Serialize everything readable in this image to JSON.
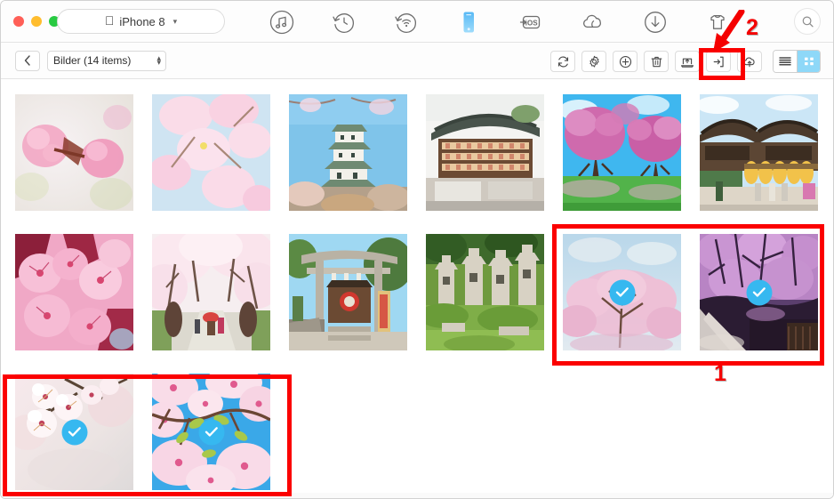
{
  "window": {
    "traffic_lights": [
      {
        "name": "close",
        "color": "#ff5f57"
      },
      {
        "name": "minimize",
        "color": "#ffbd2e"
      },
      {
        "name": "zoom",
        "color": "#28ca42"
      }
    ]
  },
  "header": {
    "device": {
      "label": "iPhone 8",
      "apple_glyph": "",
      "caret": "⌄"
    },
    "nav_items": [
      {
        "id": "music",
        "icon": "music-note-circle-icon",
        "active": false
      },
      {
        "id": "backup",
        "icon": "backup-restore-clock-icon",
        "active": false
      },
      {
        "id": "wireless",
        "icon": "wireless-sync-icon",
        "active": false
      },
      {
        "id": "device",
        "icon": "phone-device-icon",
        "active": true
      },
      {
        "id": "toios",
        "icon": "to-ios-transfer-icon",
        "active": false
      },
      {
        "id": "cloud",
        "icon": "icloud-icon",
        "active": false
      },
      {
        "id": "download",
        "icon": "download-arrow-icon",
        "active": false
      },
      {
        "id": "ringtone",
        "icon": "ringtone-shirt-icon",
        "active": false
      }
    ],
    "search": {
      "icon": "search-icon"
    }
  },
  "subbar": {
    "back": {
      "icon": "chevron-left-icon",
      "label": "‹"
    },
    "path": {
      "value": "Bilder (14 items)",
      "caret_up": "▴",
      "caret_down": "▾"
    },
    "tools": [
      {
        "id": "refresh",
        "icon": "refresh-icon",
        "highlighted": false
      },
      {
        "id": "settings",
        "icon": "gear-icon",
        "highlighted": false
      },
      {
        "id": "add",
        "icon": "plus-circle-icon",
        "highlighted": false
      },
      {
        "id": "delete",
        "icon": "trash-icon",
        "highlighted": false
      },
      {
        "id": "export-to-mac",
        "icon": "export-to-computer-icon",
        "highlighted": false
      },
      {
        "id": "export",
        "icon": "export-arrow-icon",
        "highlighted": true
      },
      {
        "id": "upload-cloud",
        "icon": "cloud-upload-icon",
        "highlighted": false
      }
    ],
    "view_modes": [
      {
        "id": "list",
        "icon": "list-view-icon",
        "active": false
      },
      {
        "id": "grid",
        "icon": "grid-view-icon",
        "active": true
      }
    ]
  },
  "grid": {
    "count": 14,
    "photos": [
      {
        "id": "p1",
        "name": "cherry-blossom-closeup-pink",
        "selected": false
      },
      {
        "id": "p2",
        "name": "cherry-blossom-branches-sky",
        "selected": false
      },
      {
        "id": "p3",
        "name": "osaka-castle",
        "selected": false
      },
      {
        "id": "p4",
        "name": "shrine-lanterns-building",
        "selected": false
      },
      {
        "id": "p5",
        "name": "blossom-trees-park-lawn",
        "selected": false
      },
      {
        "id": "p6",
        "name": "temple-golden-curtains",
        "selected": false
      },
      {
        "id": "p7",
        "name": "pink-blossoms-macro",
        "selected": false
      },
      {
        "id": "p8",
        "name": "blossom-tunnel-path",
        "selected": false
      },
      {
        "id": "p9",
        "name": "torii-gate-shrine",
        "selected": false
      },
      {
        "id": "p10",
        "name": "stone-lanterns-moss",
        "selected": false
      },
      {
        "id": "p11",
        "name": "blossom-tree-blue-sky",
        "selected": true
      },
      {
        "id": "p12",
        "name": "weeping-cherry-lane",
        "selected": true
      },
      {
        "id": "p13",
        "name": "white-blossoms-branch",
        "selected": true
      },
      {
        "id": "p14",
        "name": "pink-blossoms-bright-sky",
        "selected": true
      }
    ]
  },
  "annotations": [
    {
      "id": "box-selected-right",
      "name": "selection-highlight-box",
      "label": "1"
    },
    {
      "id": "box-selected-bottom",
      "name": "selection-highlight-box",
      "label": ""
    },
    {
      "id": "box-export-button",
      "name": "export-button-highlight-box",
      "label": "2"
    }
  ],
  "annotation_labels": {
    "step1": "1",
    "step2": "2"
  },
  "colors": {
    "annotation_red": "#fb0000",
    "check_blue": "#36b8f0",
    "active_toggle": "#8ed8f8",
    "device_blue": "#4aa8f0"
  }
}
